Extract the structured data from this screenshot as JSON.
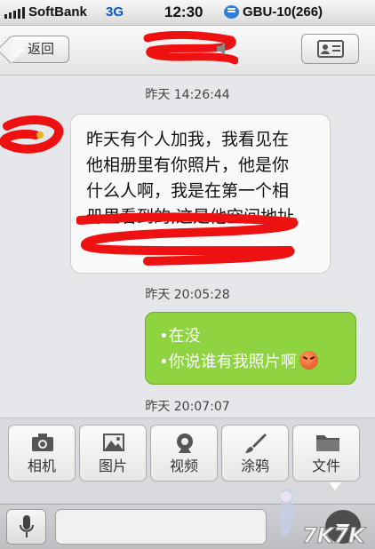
{
  "status_bar": {
    "carrier": "SoftBank",
    "network": "3G",
    "time": "12:30",
    "notification": "GBU-10(266)"
  },
  "nav": {
    "back_label": "返回",
    "icons": [
      "speaker-icon",
      "profile-card-icon"
    ]
  },
  "messages": [
    {
      "kind": "timestamp",
      "text": "昨天 14:26:44"
    },
    {
      "kind": "incoming",
      "lines": [
        "昨天有个人加我，我看见在",
        "他相册里有你照片，他是你",
        "什么人啊，我是在第一个相",
        "册里看到的,这是他空间地址"
      ]
    },
    {
      "kind": "timestamp",
      "text": "昨天 20:05:28"
    },
    {
      "kind": "outgoing",
      "lines": [
        "•在没",
        "•你说谁有我照片啊"
      ],
      "emoji": "angry-face-icon"
    },
    {
      "kind": "timestamp",
      "text": "昨天 20:07:07"
    }
  ],
  "toolbar": {
    "items": [
      {
        "label": "相机",
        "icon": "camera-icon"
      },
      {
        "label": "图片",
        "icon": "image-icon"
      },
      {
        "label": "视频",
        "icon": "webcam-icon"
      },
      {
        "label": "涂鸦",
        "icon": "brush-icon"
      },
      {
        "label": "文件",
        "icon": "folder-icon"
      }
    ]
  },
  "colors": {
    "outgoing_bubble": "#8fd341",
    "incoming_bubble": "#fafafa",
    "redaction": "#ee1111"
  },
  "watermark": "7K7K GAME"
}
